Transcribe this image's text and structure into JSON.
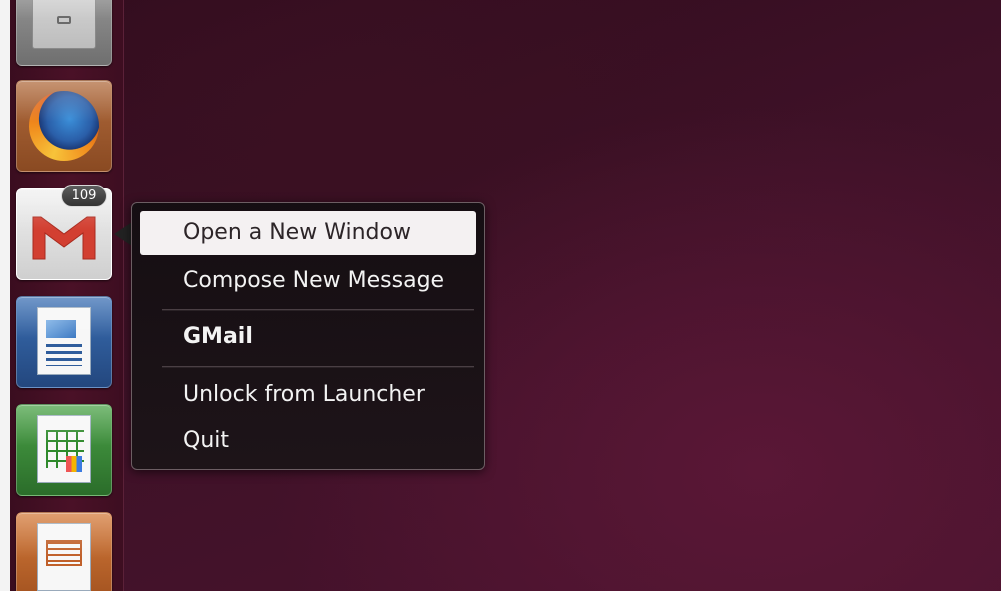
{
  "launcher": {
    "items": [
      {
        "id": "files",
        "icon": "file-cabinet-icon"
      },
      {
        "id": "firefox",
        "icon": "firefox-icon"
      },
      {
        "id": "gmail",
        "icon": "gmail-icon",
        "badge": "109"
      },
      {
        "id": "writer",
        "icon": "libreoffice-writer-icon"
      },
      {
        "id": "calc",
        "icon": "libreoffice-calc-icon"
      },
      {
        "id": "impress",
        "icon": "libreoffice-impress-icon"
      }
    ]
  },
  "quicklist": {
    "items": [
      {
        "label": "Open a New Window",
        "selected": true
      },
      {
        "label": "Compose New Message"
      },
      {
        "label": "GMail",
        "bold": true
      },
      {
        "label": "Unlock from Launcher"
      },
      {
        "label": "Quit"
      }
    ]
  },
  "colors": {
    "desktop": "#3e1127",
    "launcher": "#4a1127",
    "menu_background": "#1c1418",
    "menu_selected": "#f4f1f2",
    "gmail_red": "#d23f31"
  }
}
